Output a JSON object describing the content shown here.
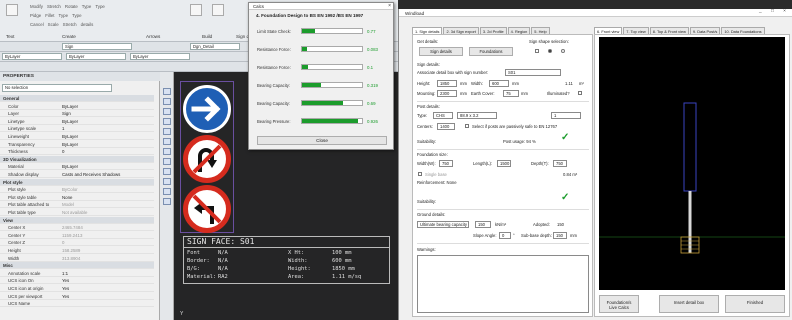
{
  "ribbon": {
    "row1": [
      "Modify",
      "Stretch",
      "Rotate",
      "Mirror",
      "Fillet",
      "Type",
      "Type",
      "Type"
    ],
    "row2": [
      "Pidge",
      "Fillet",
      "Type",
      "Type",
      "Align",
      "Edit"
    ],
    "row3": [
      "Cancel",
      "Style",
      "Scale",
      "Stretch",
      "Type",
      "details"
    ],
    "groups": [
      "Text",
      "Create",
      "Arrows",
      "Build",
      "Sign d"
    ],
    "label_sign": "Sign",
    "label_sign2": "Dgn_Detail",
    "layer_value": "ByLayer",
    "layer_value2": "ByLayer",
    "layer_value3": "ByLayer"
  },
  "properties": {
    "title": "PROPERTIES",
    "selection": "No selection",
    "rows": [
      {
        "kind": "sec",
        "k": "General",
        "v": ""
      },
      {
        "kind": "row",
        "k": "Color",
        "v": "ByLayer"
      },
      {
        "kind": "row",
        "k": "Layer",
        "v": "Sign"
      },
      {
        "kind": "row",
        "k": "Linetype",
        "v": "ByLayer"
      },
      {
        "kind": "row",
        "k": "Linetype scale",
        "v": "1"
      },
      {
        "kind": "row",
        "k": "Lineweight",
        "v": "ByLayer"
      },
      {
        "kind": "row",
        "k": "Transparency",
        "v": "ByLayer"
      },
      {
        "kind": "row",
        "k": "Thickness",
        "v": "0"
      },
      {
        "kind": "sec",
        "k": "3D Visualization",
        "v": ""
      },
      {
        "kind": "row",
        "k": "Material",
        "v": "ByLayer"
      },
      {
        "kind": "row",
        "k": "Shadow display",
        "v": "Casts and Receives Shadows"
      },
      {
        "kind": "sec",
        "k": "Plot style",
        "v": ""
      },
      {
        "kind": "dim",
        "k": "Plot style",
        "v": "ByColor"
      },
      {
        "kind": "row",
        "k": "Plot style table",
        "v": "None"
      },
      {
        "kind": "dim",
        "k": "Plot table attached to",
        "v": "Model"
      },
      {
        "kind": "dim",
        "k": "Plot table type",
        "v": "Not available"
      },
      {
        "kind": "sec",
        "k": "View",
        "v": ""
      },
      {
        "kind": "dim",
        "k": "Center X",
        "v": "2465.7484"
      },
      {
        "kind": "dim",
        "k": "Center Y",
        "v": "1159.2413"
      },
      {
        "kind": "dim",
        "k": "Center Z",
        "v": "0"
      },
      {
        "kind": "dim",
        "k": "Height",
        "v": "158.2589"
      },
      {
        "kind": "dim",
        "k": "Width",
        "v": "313.8904"
      },
      {
        "kind": "sec",
        "k": "Misc",
        "v": ""
      },
      {
        "kind": "row",
        "k": "Annotation scale",
        "v": "1:1"
      },
      {
        "kind": "row",
        "k": "UCS icon On",
        "v": "Yes"
      },
      {
        "kind": "row",
        "k": "UCS icon at origin",
        "v": "Yes"
      },
      {
        "kind": "row",
        "k": "UCS per viewport",
        "v": "Yes"
      },
      {
        "kind": "row",
        "k": "UCS Name",
        "v": ""
      }
    ]
  },
  "sign_face": {
    "title": "SIGN FACE: S01",
    "font_k": "Font",
    "font_v": "N/A",
    "border_k": "Border:",
    "border_v": "N/A",
    "bg_k": "B/G:",
    "bg_v": "N/A",
    "material_k": "Material:",
    "material_v": "RA2",
    "xht_k": "X Ht:",
    "xht_v": "100 mm",
    "width_k": "Width:",
    "width_v": "600 mm",
    "height_k": "Height:",
    "height_v": "1850 mm",
    "area_k": "Area:",
    "area_v": "1.11 m/sq",
    "axis_y": "Y"
  },
  "calcs": {
    "window_title": "Calcs",
    "heading": "4. Foundation Design to BS EN 1992 /BS EN 1997",
    "rows": [
      {
        "label": "Limit State Check:",
        "value": "0.77",
        "fill": 0.22
      },
      {
        "label": "Resistance Force:",
        "value": "0.083",
        "fill": 0.08
      },
      {
        "label": "Resistance Force:",
        "value": "0.1",
        "fill": 0.1
      },
      {
        "label": "Bearing Capacity:",
        "value": "0.319",
        "fill": 0.32
      },
      {
        "label": "Bearing Capacity:",
        "value": "0.69",
        "fill": 0.69
      },
      {
        "label": "Bearing Pressure:",
        "value": "0.926",
        "fill": 0.93
      }
    ],
    "close_label": "Close"
  },
  "windload": {
    "window_title": "Windload",
    "window_controls": "_ □ ×",
    "tabs_left": [
      "1. Sign details",
      "2. 3d Sign export",
      "3. 2d Profile",
      "4. Region",
      "5. Help"
    ],
    "tabs_right": [
      "6. Front view",
      "7. Top view",
      "8. Top & Front view",
      "9. Data Post/s",
      "10. Data Foundations"
    ],
    "get_details": "Get details:",
    "sign_details_btn": "Sign details",
    "foundations_btn": "Foundations",
    "shape_label": "Sign shape selection:",
    "sign_details_h": "Sign details:",
    "associate_label": "Associate detail box with sign number:",
    "sign_number": "S01",
    "height_label": "Height:",
    "height_val": "1850",
    "mm1": "mm",
    "width_label": "Width:",
    "width_val": "600",
    "mm2": "mm",
    "area_val": "1.11",
    "area_unit": "m²",
    "mounting_label": "Mounting:",
    "mounting_val": "2300",
    "mm3": "mm",
    "earth_label": "Earth Cover:",
    "earth_val": "75",
    "mm4": "mm",
    "illuminated_label": "Illuminated?",
    "post_details_h": "Post details:",
    "type_label": "Type:",
    "type_val": "CHS",
    "section_val": "88.9 x 3.2",
    "post_count": "1",
    "centers_label": "Centers:",
    "centers_val": "1400",
    "passive_label": "Select if posts are passively safe to EN 12767",
    "suitability_label": "Suitability:",
    "post_usage": "Post usage: 94 %",
    "foundation_h": "Foundation size:",
    "fwidth_label": "Width(W):",
    "fwidth_val": "750",
    "flength_label": "Length(L):",
    "flength_val": "1500",
    "fdepth_label": "Depth(T):",
    "fdepth_val": "750",
    "single_base": "Single base",
    "volume": "0.84 m³",
    "reinforcement": "Reinforcement: None",
    "suitability2_label": "Suitability:",
    "ground_h": "Ground details:",
    "bearing_select": "Ultimate bearing capacity",
    "bearing_val": "150",
    "bearing_unit": "kN/m²",
    "adopted_label": "Adopted:",
    "adopted_val": "150",
    "slope_label": "Slope Angle:",
    "slope_val": "0",
    "slope_unit": "°",
    "subbase_label": "Sub-base depth:",
    "subbase_val": "150",
    "subbase_unit": "mm",
    "warnings_label": "Warnings:",
    "btn_foundation": "Foundation/s\nLive Calcs",
    "btn_insert": "Insert detail box",
    "btn_finished": "Finished"
  }
}
